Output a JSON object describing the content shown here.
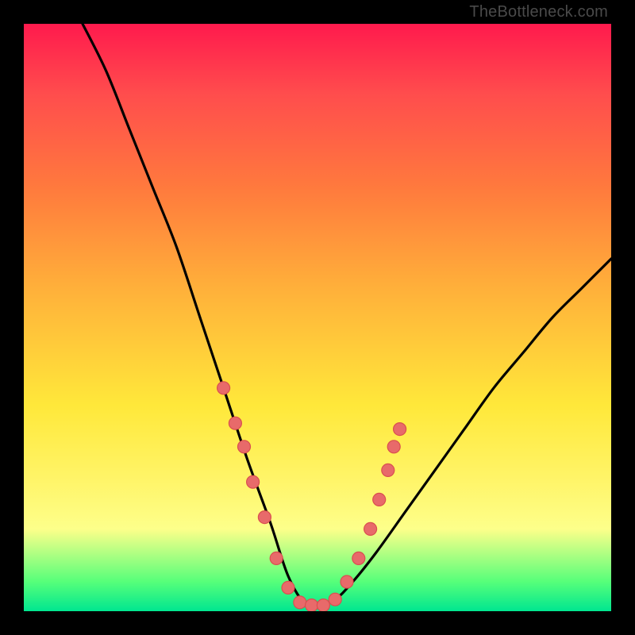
{
  "watermark": "TheBottleneck.com",
  "chart_data": {
    "type": "line",
    "title": "",
    "xlabel": "",
    "ylabel": "",
    "xlim": [
      0,
      100
    ],
    "ylim": [
      0,
      100
    ],
    "grid": false,
    "series": [
      {
        "name": "bottleneck-curve",
        "description": "V-shaped bottleneck curve; y is percentage mismatch, minimum near x≈48",
        "x": [
          10,
          14,
          18,
          22,
          26,
          30,
          34,
          38,
          42,
          45,
          48,
          50,
          53,
          56,
          60,
          65,
          70,
          75,
          80,
          85,
          90,
          95,
          100
        ],
        "y": [
          100,
          92,
          82,
          72,
          62,
          50,
          38,
          26,
          15,
          6,
          1,
          1,
          2,
          5,
          10,
          17,
          24,
          31,
          38,
          44,
          50,
          55,
          60
        ]
      }
    ],
    "markers": {
      "name": "sample-points",
      "description": "Highlighted sample dots along lower part of curve",
      "points": [
        {
          "x": 34,
          "y": 38
        },
        {
          "x": 36,
          "y": 32
        },
        {
          "x": 37.5,
          "y": 28
        },
        {
          "x": 39,
          "y": 22
        },
        {
          "x": 41,
          "y": 16
        },
        {
          "x": 43,
          "y": 9
        },
        {
          "x": 45,
          "y": 4
        },
        {
          "x": 47,
          "y": 1.5
        },
        {
          "x": 49,
          "y": 1
        },
        {
          "x": 51,
          "y": 1
        },
        {
          "x": 53,
          "y": 2
        },
        {
          "x": 55,
          "y": 5
        },
        {
          "x": 57,
          "y": 9
        },
        {
          "x": 59,
          "y": 14
        },
        {
          "x": 60.5,
          "y": 19
        },
        {
          "x": 62,
          "y": 24
        },
        {
          "x": 63,
          "y": 28
        },
        {
          "x": 64,
          "y": 31
        }
      ]
    }
  }
}
